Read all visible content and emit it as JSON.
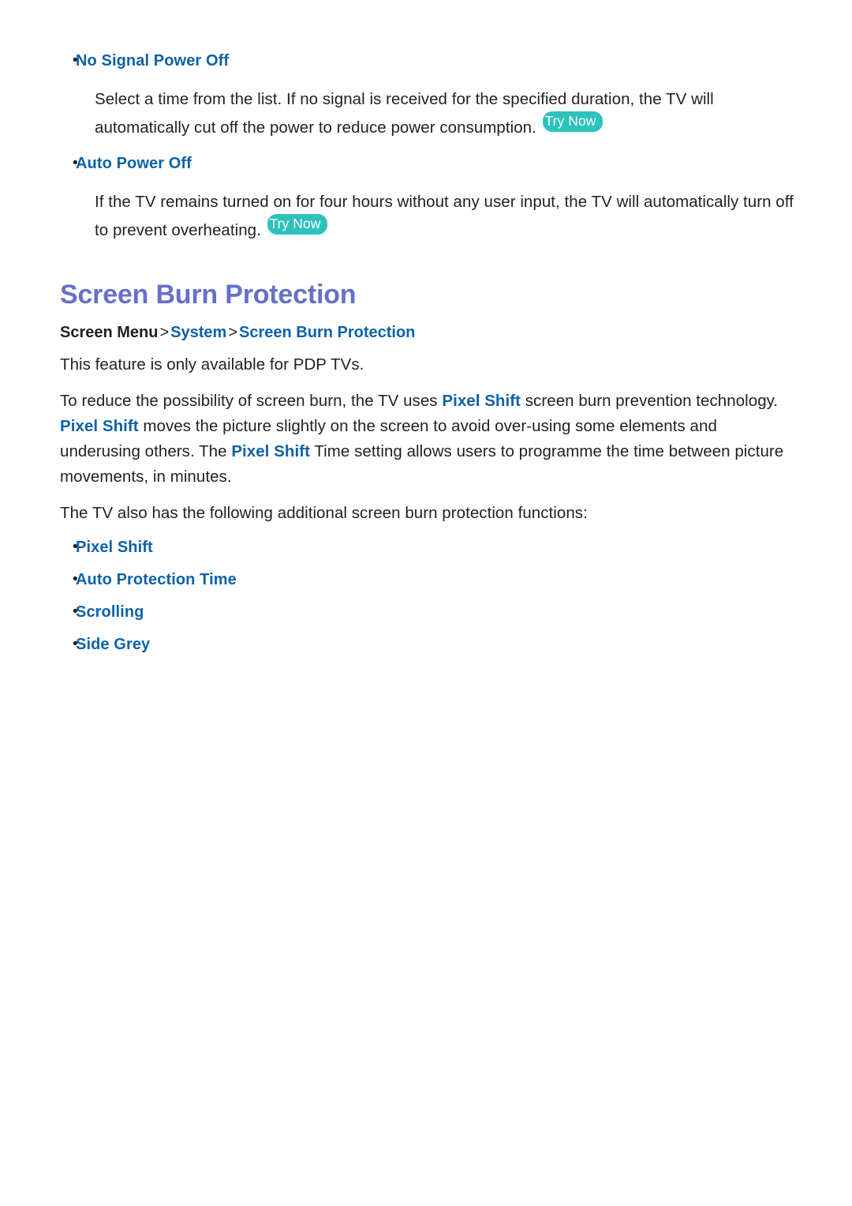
{
  "document": {
    "sections": [
      {
        "id": "no-signal-power-off",
        "bullet_label": "No Signal Power Off",
        "paragraph_parts": [
          {
            "type": "text",
            "value": "Select a time from the list. If no signal is received for the specified duration, the TV will automatically cut off the power to reduce power consumption. "
          },
          {
            "type": "badge",
            "value": "Try Now"
          }
        ],
        "paragraph_text": "Select a time from the list. If no signal is received for the specified duration, the TV will automatically cut off the power to reduce power consumption. ",
        "badge_label": "Try Now"
      },
      {
        "id": "auto-power-off",
        "bullet_label": "Auto Power Off",
        "paragraph_text": "If the TV remains turned on for four hours without any user input, the TV will automatically turn off to prevent overheating. ",
        "badge_label": "Try Now"
      }
    ]
  },
  "screen_burn_protection": {
    "title": "Screen Burn Protection",
    "breadcrumb": {
      "root": "Screen Menu",
      "separator": ">",
      "level_2": "System",
      "level_3": "Screen Burn Protection"
    },
    "availability_note": "This feature is only available for PDP TVs.",
    "description": {
      "part_1": "To reduce the possibility of screen burn, the TV uses ",
      "term_1": "Pixel Shift",
      "part_2": " screen burn prevention technology. ",
      "term_2": "Pixel Shift",
      "part_3": " moves the picture slightly on the screen to avoid over-using some elements and underusing others. The ",
      "term_3": "Pixel Shift",
      "part_4": " Time setting allows users to programme the time between picture movements, in minutes."
    },
    "functions_intro": "The TV also has the following additional screen burn protection functions:",
    "functions": [
      {
        "label": "Pixel Shift"
      },
      {
        "label": "Auto Protection Time"
      },
      {
        "label": "Scrolling"
      },
      {
        "label": "Side Grey"
      }
    ]
  },
  "colors": {
    "link_blue": "#0d62a8",
    "title_periwinkle": "#6670c8",
    "badge_teal": "#2ec2bd",
    "body_text": "#231f20",
    "page_background": "#ffffff"
  }
}
